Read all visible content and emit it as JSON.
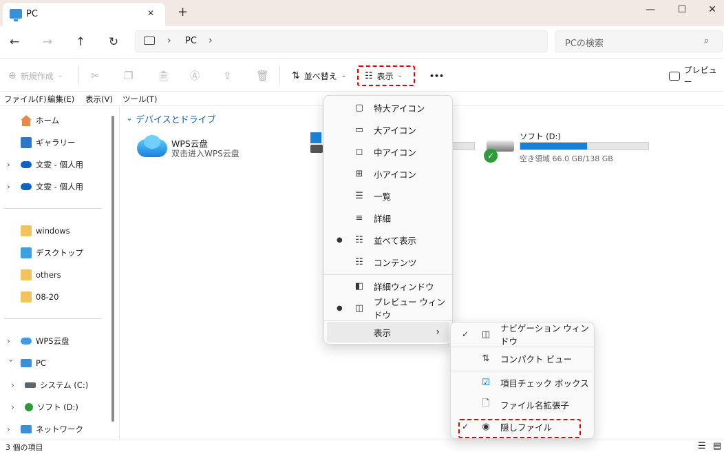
{
  "window": {
    "tab_title": "PC",
    "new_tab": "+",
    "minimize": "—",
    "maximize": "☐",
    "close": "✕",
    "tab_close": "✕"
  },
  "nav": {
    "back": "←",
    "forward": "→",
    "up": "↑",
    "refresh": "↻",
    "address_segments": [
      "PC"
    ],
    "search_placeholder": "PCの検索"
  },
  "commands": {
    "new": "新規作成",
    "sort": "並べ替え",
    "view": "表示",
    "more": "•••",
    "preview": "プレビュー"
  },
  "menubar": [
    "ファイル(F)",
    "編集(E)",
    "表示(V)",
    "ツール(T)"
  ],
  "sidebar": {
    "quick": [
      {
        "label": "ホーム",
        "icon": "home-icon"
      },
      {
        "label": "ギャラリー",
        "icon": "gallery-icon"
      },
      {
        "label": "文雯 - 個人用",
        "icon": "onedrive-icon"
      },
      {
        "label": "文雯 - 個人用",
        "icon": "onedrive-icon"
      }
    ],
    "pinned": [
      {
        "label": "windows",
        "icon": "folder-icon"
      },
      {
        "label": "デスクトップ",
        "icon": "desktop-icon"
      },
      {
        "label": "others",
        "icon": "folder-icon"
      },
      {
        "label": "08-20",
        "icon": "folder-icon"
      }
    ],
    "tree": [
      {
        "label": "WPS云盘",
        "icon": "wps-cloud-icon"
      },
      {
        "label": "PC",
        "icon": "pc-icon"
      },
      {
        "label": "システム (C:)",
        "icon": "drive-icon"
      },
      {
        "label": "ソフト (D:)",
        "icon": "drive-icon"
      },
      {
        "label": "ネットワーク",
        "icon": "network-icon"
      }
    ]
  },
  "content": {
    "section_title": "デバイスとドライブ",
    "wps": {
      "name": "WPS云盘",
      "sub": "双击进入WPS云盘"
    },
    "drive_d": {
      "name": "ソフト (D:)",
      "free": "空き領域 66.0 GB/138 GB",
      "used_fraction": 0.52
    }
  },
  "status": {
    "count": "3 個の項目"
  },
  "view_menu": {
    "items": [
      {
        "label": "特大アイコン",
        "icon": "extra-large-icons-icon"
      },
      {
        "label": "大アイコン",
        "icon": "large-icons-icon"
      },
      {
        "label": "中アイコン",
        "icon": "medium-icons-icon"
      },
      {
        "label": "小アイコン",
        "icon": "small-icons-icon"
      },
      {
        "label": "一覧",
        "icon": "list-icon"
      },
      {
        "label": "詳細",
        "icon": "details-icon"
      },
      {
        "label": "並べて表示",
        "icon": "tiles-icon",
        "selected": true
      },
      {
        "label": "コンテンツ",
        "icon": "content-icon"
      }
    ],
    "panes": [
      {
        "label": "詳細ウィンドウ",
        "icon": "details-pane-icon"
      },
      {
        "label": "プレビュー ウィンドウ",
        "icon": "preview-pane-icon",
        "selected": true
      }
    ],
    "show": {
      "label": "表示",
      "arrow": "›"
    }
  },
  "show_submenu": {
    "items": [
      {
        "label": "ナビゲーション ウィンドウ",
        "icon": "navigation-pane-icon",
        "checked": true
      },
      {
        "label": "コンパクト ビュー",
        "icon": "compact-view-icon"
      },
      {
        "label": "項目チェック ボックス",
        "icon": "checkbox-icon"
      },
      {
        "label": "ファイル名拡張子",
        "icon": "file-extension-icon"
      },
      {
        "label": "隠しファイル",
        "icon": "eye-icon",
        "checked": true
      }
    ]
  },
  "colors": {
    "titlebar": "#f3e9e4",
    "accent": "#0067c0",
    "highlight_red": "#e00000",
    "drive_bar": "#1a7fd6"
  }
}
